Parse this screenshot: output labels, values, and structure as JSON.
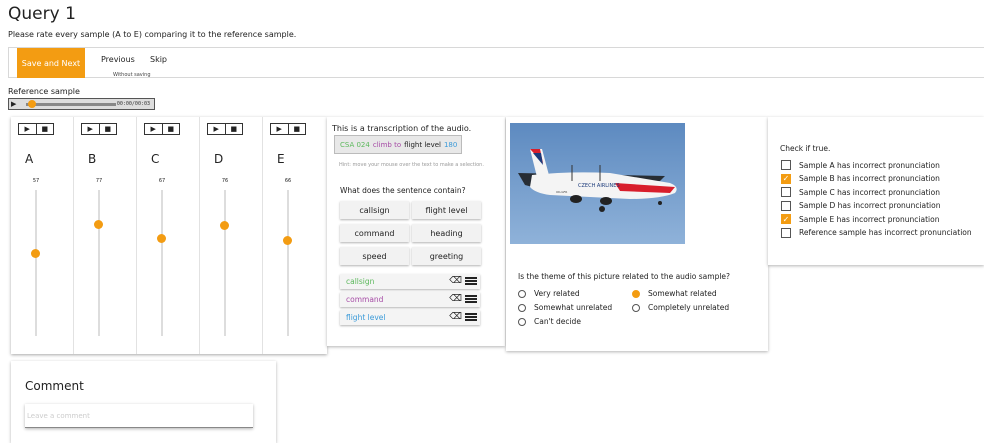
{
  "title": "Query 1",
  "subtitle": "Please rate every sample (A to E) comparing it to the reference sample.",
  "toolbar": {
    "save_next": "Save and Next",
    "previous": "Previous",
    "previous_sub": "Without saving",
    "skip": "Skip",
    "accent_color": "#f39c12"
  },
  "reference": {
    "label": "Reference sample",
    "time": "00:00/00:03",
    "play_icon": "play-icon"
  },
  "samples": [
    {
      "letter": "A",
      "value": "57",
      "level": 0.57
    },
    {
      "letter": "B",
      "value": "77",
      "level": 0.77
    },
    {
      "letter": "C",
      "value": "67",
      "level": 0.67
    },
    {
      "letter": "D",
      "value": "76",
      "level": 0.76
    },
    {
      "letter": "E",
      "value": "66",
      "level": 0.66
    }
  ],
  "transcription": {
    "title": "This is a transcription of the audio.",
    "words": [
      {
        "text": "CSA 024",
        "color": "#5cb85c"
      },
      {
        "text": "climb to",
        "color": "#a64ca6"
      },
      {
        "text": "flight level",
        "color": "#222222"
      },
      {
        "text": "180",
        "color": "#3a9ad9"
      }
    ],
    "hint": "Hint: move your mouse over the text to make a selection.",
    "contain_label": "What does the sentence contain?",
    "tags": [
      "callsign",
      "flight level",
      "command",
      "heading",
      "speed",
      "greeting"
    ],
    "selections": [
      {
        "label": "callsign",
        "color": "#5cb85c"
      },
      {
        "label": "command",
        "color": "#a64ca6"
      },
      {
        "label": "flight level",
        "color": "#3a9ad9"
      }
    ]
  },
  "image_question": {
    "question": "Is the theme of this picture related to the audio sample?",
    "options": [
      "Very related",
      "Somewhat related",
      "Somewhat unrelated",
      "Completely unrelated",
      "Can't decide"
    ],
    "selected": "Somewhat related",
    "plane_livery": "CSA",
    "plane_reg": "OK-GFR"
  },
  "checks": {
    "title": "Check if true.",
    "items": [
      {
        "label": "Sample A has incorrect pronunciation",
        "checked": false
      },
      {
        "label": "Sample B has incorrect pronunciation",
        "checked": true
      },
      {
        "label": "Sample C has incorrect pronunciation",
        "checked": false
      },
      {
        "label": "Sample D has incorrect pronunciation",
        "checked": false
      },
      {
        "label": "Sample E has incorrect pronunciation",
        "checked": true
      },
      {
        "label": "Reference sample has incorrect pronunciation",
        "checked": false
      }
    ]
  },
  "comment": {
    "title": "Comment",
    "placeholder": "Leave a comment"
  }
}
